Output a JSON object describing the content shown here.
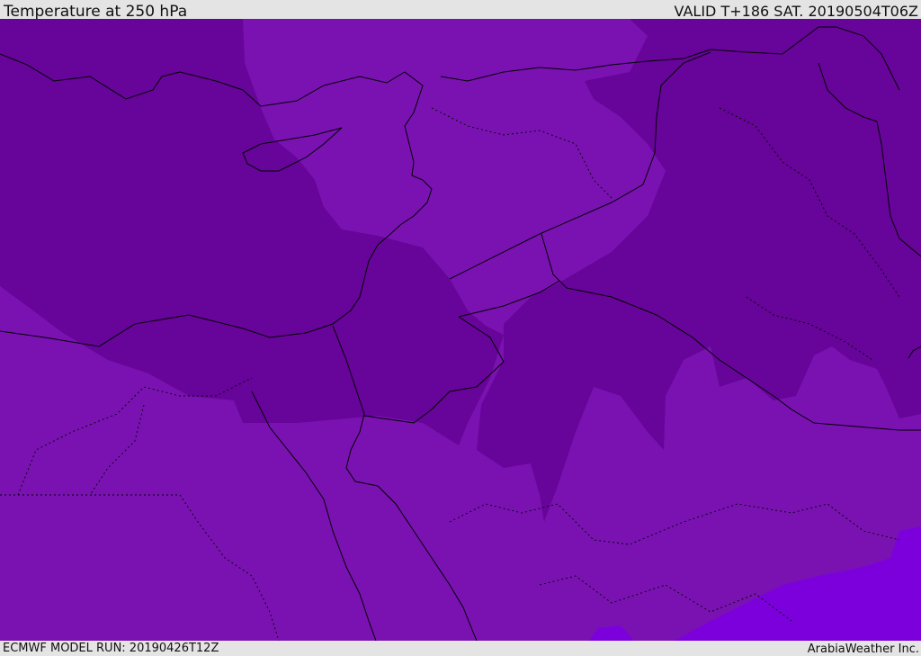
{
  "header": {
    "title": "Temperature at 250 hPa",
    "valid": "VALID T+186 SAT. 20190504T06Z"
  },
  "footer": {
    "model_run": "ECMWF MODEL RUN: 20190426T12Z",
    "brand": "ArabiaWeather Inc."
  },
  "colors": {
    "cold_shade": "#670499",
    "mid_shade": "#7a12b2",
    "warm_shade": "#7c00dc",
    "coastline": "#000000"
  }
}
